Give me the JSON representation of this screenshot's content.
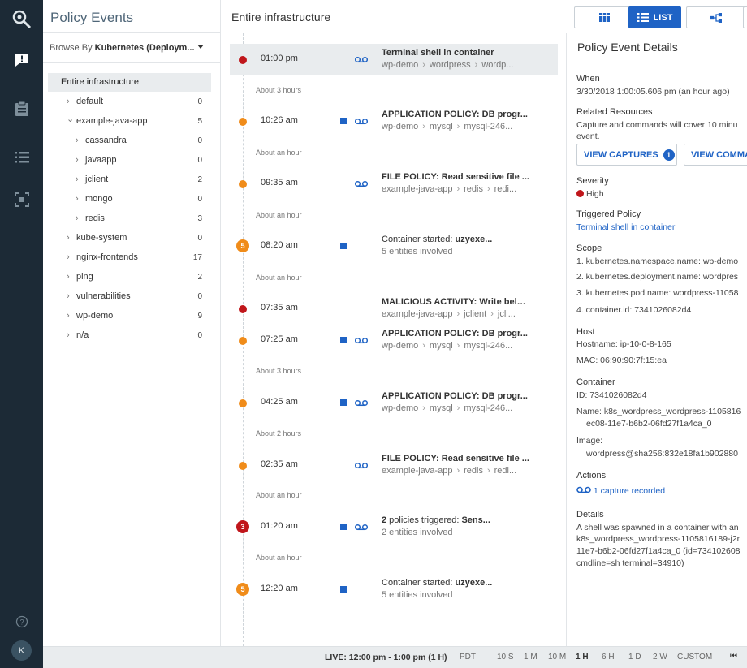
{
  "nav": {
    "icons": [
      "logo-icon",
      "policy-events-icon",
      "clipboard-icon",
      "list-icon",
      "capture-frame-icon"
    ],
    "help_icon": "help-icon",
    "user_initial": "K"
  },
  "tree": {
    "title": "Policy Events",
    "browse_prefix": "Browse By ",
    "browse_value": "Kubernetes (Deploym...",
    "root": "Entire infrastructure",
    "items": [
      {
        "label": "default",
        "count": "0",
        "level": 0,
        "expanded": false
      },
      {
        "label": "example-java-app",
        "count": "5",
        "level": 0,
        "expanded": true
      },
      {
        "label": "cassandra",
        "count": "0",
        "level": 1,
        "expanded": false
      },
      {
        "label": "javaapp",
        "count": "0",
        "level": 1,
        "expanded": false
      },
      {
        "label": "jclient",
        "count": "2",
        "level": 1,
        "expanded": false
      },
      {
        "label": "mongo",
        "count": "0",
        "level": 1,
        "expanded": false
      },
      {
        "label": "redis",
        "count": "3",
        "level": 1,
        "expanded": false
      },
      {
        "label": "kube-system",
        "count": "0",
        "level": 0,
        "expanded": false
      },
      {
        "label": "nginx-frontends",
        "count": "17",
        "level": 0,
        "expanded": false
      },
      {
        "label": "ping",
        "count": "2",
        "level": 0,
        "expanded": false
      },
      {
        "label": "vulnerabilities",
        "count": "0",
        "level": 0,
        "expanded": false
      },
      {
        "label": "wp-demo",
        "count": "9",
        "level": 0,
        "expanded": false
      },
      {
        "label": "n/a",
        "count": "0",
        "level": 0,
        "expanded": false
      }
    ]
  },
  "timeline": {
    "title": "Entire infrastructure",
    "view_buttons": {
      "grid_icon": "grid-icon",
      "list_label": "LIST",
      "topology_icon": "topology-icon"
    },
    "events": [
      {
        "time": "01:00 pm",
        "marker": "dot",
        "color": "red",
        "square": false,
        "recording": true,
        "title": "Terminal shell in container",
        "title_extra": "",
        "path": [
          "wp-demo",
          "wordpress",
          "wordp..."
        ],
        "selected": true
      },
      {
        "time": "10:26 am",
        "marker": "dot",
        "color": "orange",
        "square": true,
        "recording": true,
        "title": "APPLICATION POLICY: DB progr...",
        "title_extra": "",
        "path": [
          "wp-demo",
          "mysql",
          "mysql-246..."
        ],
        "selected": false
      },
      {
        "time": "09:35 am",
        "marker": "dot",
        "color": "orange",
        "square": false,
        "recording": true,
        "title": "FILE POLICY: Read sensitive file ...",
        "title_extra": "",
        "path": [
          "example-java-app",
          "redis",
          "redi..."
        ],
        "selected": false
      },
      {
        "time": "08:20 am",
        "marker": "num",
        "number": "5",
        "color": "orange",
        "square": true,
        "recording": false,
        "title_plain": "Container started: ",
        "title": "uzyexe...",
        "title_extra": "",
        "sub": "5 entities involved",
        "selected": false
      },
      {
        "time": "07:35 am",
        "marker": "dot",
        "color": "red",
        "square": false,
        "recording": false,
        "title": "MALICIOUS ACTIVITY: Write belo...",
        "title_extra": "",
        "path": [
          "example-java-app",
          "jclient",
          "jcli..."
        ],
        "selected": false
      },
      {
        "time": "07:25 am",
        "marker": "dot",
        "color": "orange",
        "square": true,
        "recording": true,
        "title": "APPLICATION POLICY: DB progr...",
        "title_extra": "",
        "path": [
          "wp-demo",
          "mysql",
          "mysql-246..."
        ],
        "selected": false
      },
      {
        "time": "04:25 am",
        "marker": "dot",
        "color": "orange",
        "square": true,
        "recording": true,
        "title": "APPLICATION POLICY: DB progr...",
        "title_extra": "",
        "path": [
          "wp-demo",
          "mysql",
          "mysql-246..."
        ],
        "selected": false
      },
      {
        "time": "02:35 am",
        "marker": "dot",
        "color": "orange",
        "square": false,
        "recording": true,
        "title": "FILE POLICY: Read sensitive file ...",
        "title_extra": "",
        "path": [
          "example-java-app",
          "redis",
          "redi..."
        ],
        "selected": false
      },
      {
        "time": "01:20 am",
        "marker": "num",
        "number": "3",
        "color": "red",
        "square": true,
        "recording": true,
        "title_lead": "2",
        "title_plain": " policies triggered:  ",
        "title": "Sens...",
        "title_extra": "",
        "sub": "2 entities involved",
        "selected": false
      },
      {
        "time": "12:20 am",
        "marker": "num",
        "number": "5",
        "color": "orange",
        "square": true,
        "recording": false,
        "title_plain": "Container started: ",
        "title": "uzyexe...",
        "title_extra": "",
        "sub": "5 entities involved",
        "selected": false
      }
    ],
    "gaps": [
      "About 3 hours",
      "About an hour",
      "About an hour",
      "About an hour",
      "About 3 hours",
      "About 2 hours",
      "About an hour",
      "About an hour"
    ]
  },
  "details": {
    "title": "Policy Event Details",
    "when_label": "When",
    "when_value": "3/30/2018 1:00:05.606 pm (an hour ago)",
    "related_label": "Related Resources",
    "related_text_1": "Capture and commands will cover 10 minu",
    "related_text_2": "event.",
    "view_captures": "VIEW CAPTURES",
    "captures_count": "1",
    "view_commands": "VIEW COMMA",
    "severity_label": "Severity",
    "severity_value": "High",
    "triggered_label": "Triggered Policy",
    "triggered_value": "Terminal shell in container",
    "scope_label": "Scope",
    "scope": [
      "1. kubernetes.namespace.name: wp-demo",
      "2. kubernetes.deployment.name: wordpres",
      "3. kubernetes.pod.name: wordpress-11058",
      "4. container.id: 7341026082d4"
    ],
    "host_label": "Host",
    "hostname": "Hostname: ip-10-0-8-165",
    "mac": "MAC: 06:90:90:7f:15:ea",
    "container_label": "Container",
    "container_id": "ID: 7341026082d4",
    "container_name_1": "Name: k8s_wordpress_wordpress-1105816",
    "container_name_2": "ec08-11e7-b6b2-06fd27f1a4ca_0",
    "image_label": "Image:",
    "image_value": "wordpress@sha256:832e18fa1b902880",
    "actions_label": "Actions",
    "actions_value": "1 capture recorded",
    "details_label": "Details",
    "details_lines": [
      "A shell was spawned in a container with an",
      "k8s_wordpress_wordpress-1105816189-j2r",
      "11e7-b6b2-06fd27f1a4ca_0 (id=734102608",
      "cmdline=sh terminal=34910)"
    ]
  },
  "bottom_bar": {
    "live": "LIVE: 12:00 pm - 1:00 pm (1 H)",
    "timezone": "PDT",
    "ranges": [
      "10 S",
      "1 M",
      "10 M",
      "1 H",
      "6 H",
      "1 D",
      "2 W",
      "CUSTOM"
    ],
    "selected_range": "1 H"
  },
  "colors": {
    "accent": "#1f63c5",
    "rail": "#1c2a36",
    "severity_high": "#c0161b",
    "severity_medium": "#f08c1a"
  }
}
